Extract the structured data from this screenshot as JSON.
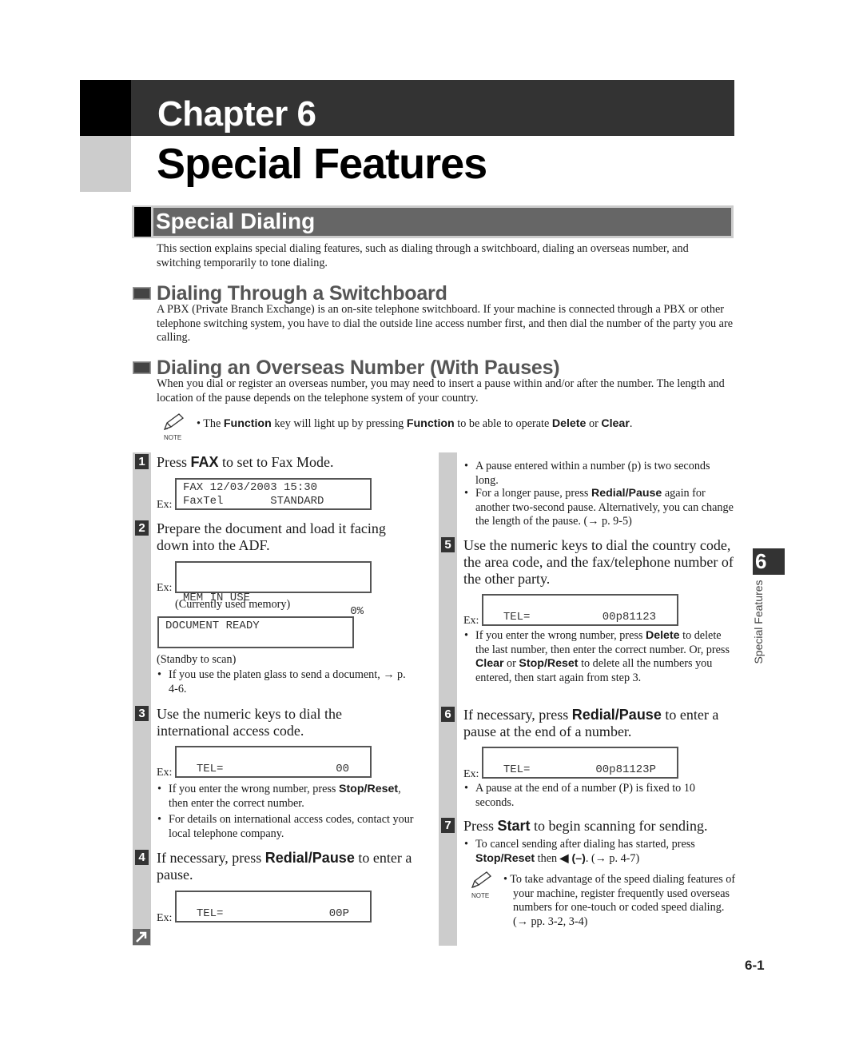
{
  "chapter": {
    "label": "Chapter 6",
    "title": "Special Features"
  },
  "section": {
    "title": "Special Dialing",
    "intro": "This section explains special dialing features, such as dialing through a switchboard, dialing an overseas number, and switching temporarily to tone dialing."
  },
  "switchboard": {
    "heading": "Dialing Through a Switchboard",
    "body": "A PBX (Private Branch Exchange) is an on-site telephone switchboard. If your machine is connected through a PBX or other telephone switching system, you have to dial the outside line access number first, and then dial the number of the party you are calling."
  },
  "overseas": {
    "heading": "Dialing an Overseas Number (With Pauses)",
    "body": "When you dial or register an overseas number, you may need to insert a pause within and/or after the number. The length and location of the pause depends on the telephone system of your country.",
    "note": {
      "label": "NOTE",
      "parts": [
        "• The ",
        "Function",
        " key will light up by pressing ",
        "Function",
        " to be able to operate ",
        "Delete",
        " or ",
        "Clear",
        "."
      ]
    }
  },
  "ex_label": "Ex:",
  "steps": {
    "s1": {
      "num": "1",
      "parts": [
        "Press ",
        "FAX",
        " to set to Fax Mode."
      ],
      "lcd_line1": "FAX 12/03/2003 15:30",
      "lcd_line2": "FaxTel       STANDARD"
    },
    "s2": {
      "num": "2",
      "text": "Prepare the document and load it facing down into the ADF.",
      "lcd1_line1": "MEM IN USE",
      "lcd1_line2": "0%",
      "caption1": "(Currently used memory)",
      "lcd2_line1": "DOCUMENT READY",
      "caption2": "(Standby to scan)",
      "bullet": "If you use the platen glass to send a document, → p. 4-6."
    },
    "s3": {
      "num": "3",
      "text": "Use the numeric keys to dial the international access code.",
      "lcd_left": "TEL=",
      "lcd_right": "00",
      "bullet1_bold": "Stop/Reset",
      "bullet1_pre": "If you enter the wrong number, press ",
      "bullet1_post": ", then enter the correct number.",
      "bullet2": "For details on international access codes, contact your local telephone company."
    },
    "s4": {
      "num": "4",
      "parts": [
        "If necessary, press ",
        "Redial/Pause",
        " to enter a pause."
      ],
      "lcd_left": "TEL=",
      "lcd_right": "00P",
      "bullet1": "A pause entered within a number (p) is two seconds long.",
      "bullet2_parts": [
        "For a longer pause, press ",
        "Redial/Pause",
        " again for another two-second pause. Alternatively, you can change the length of the pause. (→ p. 9-5)"
      ]
    },
    "s5": {
      "num": "5",
      "text": "Use the numeric keys to dial the country code, the area code, and the fax/telephone number of the other party.",
      "lcd_left": "TEL=",
      "lcd_right": "00p81123",
      "bullet_parts": [
        "If you enter the wrong number, press ",
        "Delete",
        " to delete the last number, then enter the correct number. Or, press ",
        "Clear",
        " or ",
        "Stop/Reset",
        " to delete all the numbers you entered, then start again from step 3."
      ]
    },
    "s6": {
      "num": "6",
      "parts": [
        "If necessary, press ",
        "Redial/Pause",
        " to enter a pause at the end of a number."
      ],
      "lcd_left": "TEL=",
      "lcd_right": "00p81123P",
      "bullet": "A pause at the end of a number (P) is fixed to 10 seconds."
    },
    "s7": {
      "num": "7",
      "parts": [
        "Press ",
        "Start",
        " to begin scanning for sending."
      ],
      "bullet_parts": [
        "To cancel sending after dialing has started, press ",
        "Stop/Reset",
        " then ",
        "◀ (–)",
        ". (→ p. 4-7)"
      ],
      "note_label": "NOTE",
      "note": "• To take advantage of the speed dialing features of your machine, register frequently used overseas numbers for one-touch or coded speed dialing. (→ pp. 3-2, 3-4)"
    }
  },
  "side_tab": {
    "number": "6",
    "label": "Special Features"
  },
  "page_number": "6-1"
}
